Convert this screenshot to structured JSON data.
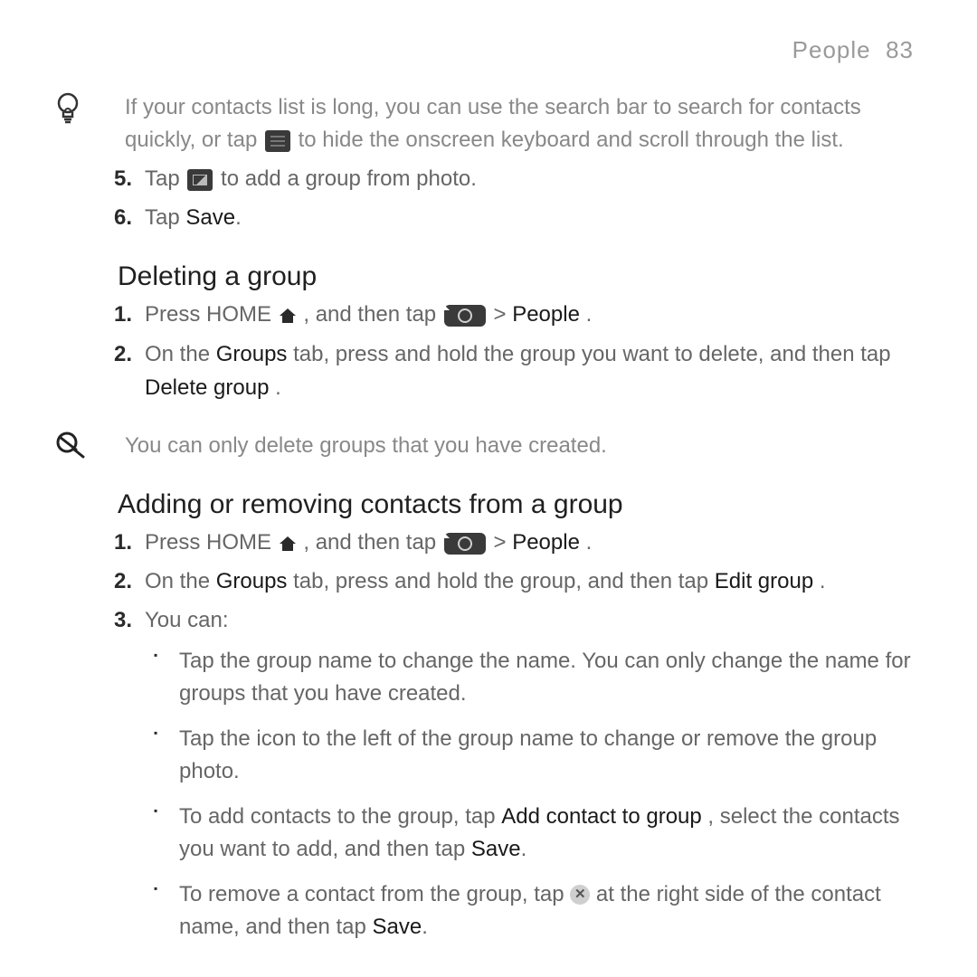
{
  "header": {
    "section": "People",
    "page": "83"
  },
  "tip": {
    "part1": "If your contacts list is long, you can use the search bar to search for contacts quickly, or tap ",
    "part2": " to hide the onscreen keyboard and scroll through the list."
  },
  "steps_top": {
    "s5": {
      "num": "5.",
      "a": "Tap ",
      "b": " to add a group from photo."
    },
    "s6": {
      "num": "6.",
      "a": "Tap ",
      "save": "Save",
      "b": "."
    }
  },
  "delete_heading": "Deleting a group",
  "delete_steps": {
    "s1": {
      "num": "1.",
      "a": "Press HOME ",
      "b": ", and then tap ",
      "c": " > ",
      "people": "People",
      "d": " ."
    },
    "s2": {
      "num": "2.",
      "a": "On the ",
      "groups": "Groups",
      "b": "  tab, press and hold the group you want to delete, and then tap ",
      "deletegroup": "Delete group",
      "c": "   ."
    }
  },
  "note": {
    "text": "You can only delete groups that you have created."
  },
  "addrem_heading": "Adding or removing contacts from a group",
  "addrem_steps": {
    "s1": {
      "num": "1.",
      "a": "Press HOME ",
      "b": ", and then tap ",
      "c": " > ",
      "people": "People",
      "d": " ."
    },
    "s2": {
      "num": "2.",
      "a": "On the ",
      "groups": "Groups",
      "b": "  tab, press and hold the group, and then tap ",
      "editgroup": "Edit group",
      "c": " ."
    },
    "s3": {
      "num": "3.",
      "lead": "You can:",
      "b1": "Tap the group name to change the name. You can only change the name for groups that you have created.",
      "b2": "Tap the icon to the left of the group name to change or remove the group photo.",
      "b3a": "To add contacts to the group, tap ",
      "b3_add": "Add contact to group",
      "b3b": "     , select the contacts you want to add, and then tap ",
      "b3_save": "Save",
      "b3c": ".",
      "b4a": "To remove a contact from the group, tap ",
      "b4b": " at the right side of the contact name, and then tap ",
      "b4_save": "Save",
      "b4c": "."
    }
  }
}
